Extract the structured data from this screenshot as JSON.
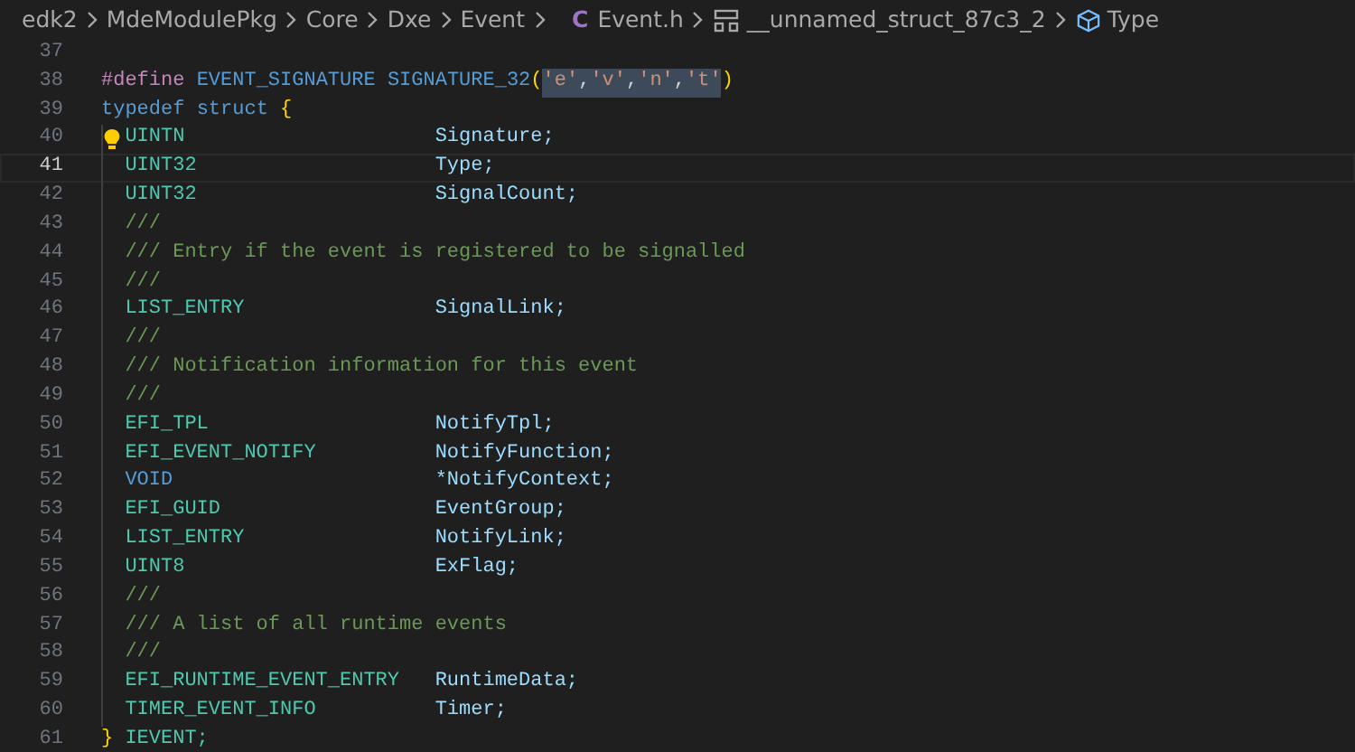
{
  "breadcrumb": [
    {
      "label": "edk2",
      "kind": "folder"
    },
    {
      "label": "MdeModulePkg",
      "kind": "folder"
    },
    {
      "label": "Core",
      "kind": "folder"
    },
    {
      "label": "Dxe",
      "kind": "folder"
    },
    {
      "label": "Event",
      "kind": "folder"
    },
    {
      "label": "Event.h",
      "kind": "c-file",
      "icon_text": "C"
    },
    {
      "label": "__unnamed_struct_87c3_2",
      "kind": "struct"
    },
    {
      "label": "Type",
      "kind": "field"
    }
  ],
  "editor": {
    "lines": [
      {
        "number": "37",
        "kind": "blank",
        "current": false,
        "lightbulb": false,
        "indented": false
      },
      {
        "number": "38",
        "kind": "code",
        "current": false,
        "lightbulb": false,
        "indented": false,
        "tokens": [
          {
            "text": "#define",
            "kind": "directive",
            "spaced": false,
            "highlighted": false
          },
          {
            "text": "EVENT_SIGNATURE",
            "kind": "macro",
            "spaced": true,
            "highlighted": false
          },
          {
            "text": "SIGNATURE_32",
            "kind": "macro",
            "spaced": true,
            "highlighted": false
          },
          {
            "text": "(",
            "kind": "bracket",
            "spaced": false,
            "highlighted": false
          },
          {
            "text": "'e'",
            "kind": "string",
            "spaced": false,
            "highlighted": true
          },
          {
            "text": ",",
            "kind": "plain",
            "spaced": false,
            "highlighted": true
          },
          {
            "text": "'v'",
            "kind": "string",
            "spaced": false,
            "highlighted": true
          },
          {
            "text": ",",
            "kind": "plain",
            "spaced": false,
            "highlighted": true
          },
          {
            "text": "'n'",
            "kind": "string",
            "spaced": false,
            "highlighted": true
          },
          {
            "text": ",",
            "kind": "plain",
            "spaced": false,
            "highlighted": true
          },
          {
            "text": "'t'",
            "kind": "string",
            "spaced": false,
            "highlighted": true
          },
          {
            "text": ")",
            "kind": "bracket",
            "spaced": false,
            "highlighted": false
          }
        ]
      },
      {
        "number": "39",
        "kind": "code",
        "current": false,
        "lightbulb": false,
        "indented": false,
        "tokens": [
          {
            "text": "typedef",
            "kind": "keyword",
            "spaced": false
          },
          {
            "text": "struct",
            "kind": "keyword",
            "spaced": true
          },
          {
            "text": "{",
            "kind": "bracket",
            "spaced": true
          }
        ]
      },
      {
        "number": "40",
        "kind": "member",
        "current": false,
        "lightbulb": true,
        "indented": true,
        "type": {
          "text": "UINTN",
          "kind": "type"
        },
        "name": "Signature;"
      },
      {
        "number": "41",
        "kind": "member",
        "current": true,
        "lightbulb": false,
        "indented": true,
        "type": {
          "text": "UINT32",
          "kind": "type"
        },
        "name": "Type;"
      },
      {
        "number": "42",
        "kind": "member",
        "current": false,
        "lightbulb": false,
        "indented": true,
        "type": {
          "text": "UINT32",
          "kind": "type"
        },
        "name": "SignalCount;"
      },
      {
        "number": "43",
        "kind": "comment",
        "current": false,
        "lightbulb": false,
        "indented": true,
        "text": "///"
      },
      {
        "number": "44",
        "kind": "comment",
        "current": false,
        "lightbulb": false,
        "indented": true,
        "text": "/// Entry if the event is registered to be signalled"
      },
      {
        "number": "45",
        "kind": "comment",
        "current": false,
        "lightbulb": false,
        "indented": true,
        "text": "///"
      },
      {
        "number": "46",
        "kind": "member",
        "current": false,
        "lightbulb": false,
        "indented": true,
        "type": {
          "text": "LIST_ENTRY",
          "kind": "type"
        },
        "name": "SignalLink;"
      },
      {
        "number": "47",
        "kind": "comment",
        "current": false,
        "lightbulb": false,
        "indented": true,
        "text": "///"
      },
      {
        "number": "48",
        "kind": "comment",
        "current": false,
        "lightbulb": false,
        "indented": true,
        "text": "/// Notification information for this event"
      },
      {
        "number": "49",
        "kind": "comment",
        "current": false,
        "lightbulb": false,
        "indented": true,
        "text": "///"
      },
      {
        "number": "50",
        "kind": "member",
        "current": false,
        "lightbulb": false,
        "indented": true,
        "type": {
          "text": "EFI_TPL",
          "kind": "type"
        },
        "name": "NotifyTpl;"
      },
      {
        "number": "51",
        "kind": "member",
        "current": false,
        "lightbulb": false,
        "indented": true,
        "type": {
          "text": "EFI_EVENT_NOTIFY",
          "kind": "type"
        },
        "name": "NotifyFunction;"
      },
      {
        "number": "52",
        "kind": "member",
        "current": false,
        "lightbulb": false,
        "indented": true,
        "type": {
          "text": "VOID",
          "kind": "keyword"
        },
        "name": "*NotifyContext;"
      },
      {
        "number": "53",
        "kind": "member",
        "current": false,
        "lightbulb": false,
        "indented": true,
        "type": {
          "text": "EFI_GUID",
          "kind": "type"
        },
        "name": "EventGroup;"
      },
      {
        "number": "54",
        "kind": "member",
        "current": false,
        "lightbulb": false,
        "indented": true,
        "type": {
          "text": "LIST_ENTRY",
          "kind": "type"
        },
        "name": "NotifyLink;"
      },
      {
        "number": "55",
        "kind": "member",
        "current": false,
        "lightbulb": false,
        "indented": true,
        "type": {
          "text": "UINT8",
          "kind": "type"
        },
        "name": "ExFlag;"
      },
      {
        "number": "56",
        "kind": "comment",
        "current": false,
        "lightbulb": false,
        "indented": true,
        "text": "///"
      },
      {
        "number": "57",
        "kind": "comment",
        "current": false,
        "lightbulb": false,
        "indented": true,
        "text": "/// A list of all runtime events"
      },
      {
        "number": "58",
        "kind": "comment",
        "current": false,
        "lightbulb": false,
        "indented": true,
        "text": "///"
      },
      {
        "number": "59",
        "kind": "member",
        "current": false,
        "lightbulb": false,
        "indented": true,
        "type": {
          "text": "EFI_RUNTIME_EVENT_ENTRY",
          "kind": "type"
        },
        "name": "RuntimeData;"
      },
      {
        "number": "60",
        "kind": "member",
        "current": false,
        "lightbulb": false,
        "indented": true,
        "type": {
          "text": "TIMER_EVENT_INFO",
          "kind": "type"
        },
        "name": "Timer;"
      },
      {
        "number": "61",
        "kind": "code",
        "current": false,
        "lightbulb": false,
        "indented": false,
        "tokens": [
          {
            "text": "}",
            "kind": "bracket",
            "spaced": false
          },
          {
            "text": "IEVENT;",
            "kind": "type",
            "spaced": true
          }
        ]
      }
    ]
  }
}
